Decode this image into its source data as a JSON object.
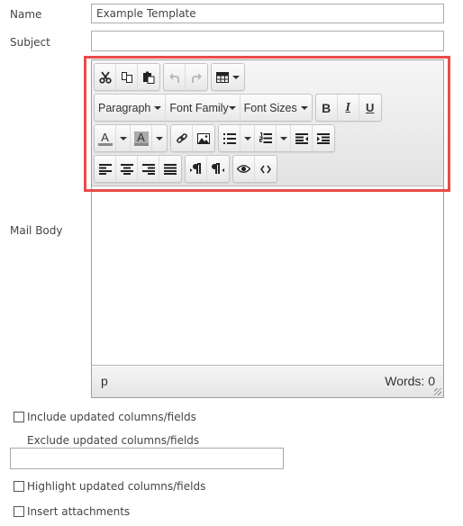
{
  "form": {
    "name_label": "Name",
    "name_value": "Example Template",
    "subject_label": "Subject",
    "subject_value": "",
    "mail_body_label": "Mail Body"
  },
  "editor": {
    "toolbar": {
      "row1": [
        {
          "icon": "cut-icon",
          "label": "Cut"
        },
        {
          "icon": "copy-icon",
          "label": "Copy"
        },
        {
          "icon": "paste-icon",
          "label": "Paste"
        },
        {
          "icon": "undo-icon",
          "label": "Undo",
          "disabled": true
        },
        {
          "icon": "redo-icon",
          "label": "Redo",
          "disabled": true
        },
        {
          "icon": "table-icon",
          "label": "Table"
        }
      ],
      "row2": {
        "paragraph_label": "Paragraph",
        "font_family_label": "Font Family",
        "font_sizes_label": "Font Sizes",
        "bold": "B",
        "italic": "I",
        "underline": "U"
      },
      "row3": {
        "text_color": "A",
        "bg_color": "A",
        "text_color_swatch": "#888888",
        "bg_color_swatch": "#aaaaaa"
      }
    },
    "status_path": "p",
    "word_count": "Words: 0"
  },
  "options": {
    "include_updated_label": "Include updated columns/fields",
    "include_updated_checked": false,
    "exclude_updated_label": "Exclude updated columns/fields",
    "exclude_updated_value": "",
    "highlight_updated_label": "Highlight updated columns/fields",
    "highlight_updated_checked": false,
    "insert_attachments_label": "Insert attachments",
    "insert_attachments_checked": false
  },
  "colors": {
    "highlight_box": "#e84c46"
  }
}
